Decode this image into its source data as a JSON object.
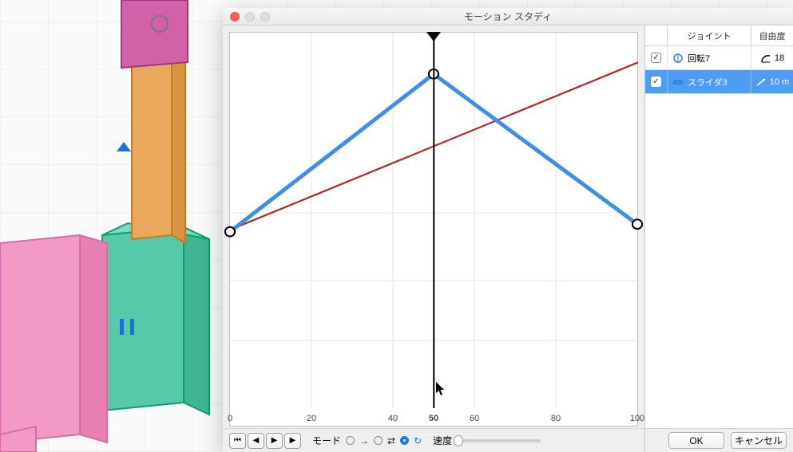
{
  "window": {
    "title": "モーション スタディ"
  },
  "chart_data": {
    "type": "line",
    "xlabel": "",
    "ylabel": "",
    "xlim": [
      0,
      100
    ],
    "xticks": [
      0,
      20,
      40,
      50,
      60,
      80,
      100
    ],
    "xticks_bold": [
      50
    ],
    "grid_v": [
      20,
      40,
      60,
      80
    ],
    "grid_h_ratios": [
      0.18,
      0.34,
      0.52
    ],
    "playhead": 50,
    "series": [
      {
        "name": "回転7",
        "color": "#b22525",
        "x": [
          0,
          100
        ],
        "y_ratio": [
          0.475,
          0.92
        ],
        "stroke": 2.2,
        "selected": false
      },
      {
        "name": "スライダ3",
        "color": "#3f8fe6",
        "x": [
          0,
          50,
          100
        ],
        "y_ratio": [
          0.47,
          0.89,
          0.49
        ],
        "stroke": 5,
        "selected": true,
        "endpoints": true
      }
    ]
  },
  "axis": {
    "ticks": [
      "0",
      "20",
      "40",
      "50",
      "60",
      "80",
      "100"
    ]
  },
  "footer": {
    "mode_label": "モード",
    "speed_label": "速度"
  },
  "side": {
    "header_joint": "ジョイント",
    "header_dof": "自由度",
    "rows": [
      {
        "checked": true,
        "icon": "rev",
        "name": "回転7",
        "dof_icon": "angle",
        "dof_val": "18",
        "selected": false
      },
      {
        "checked": true,
        "icon": "sld",
        "name": "スライダ3",
        "dof_icon": "slide",
        "dof_val": "10 m",
        "selected": true
      }
    ]
  },
  "buttons": {
    "ok": "OK",
    "cancel": "キャンセル"
  }
}
